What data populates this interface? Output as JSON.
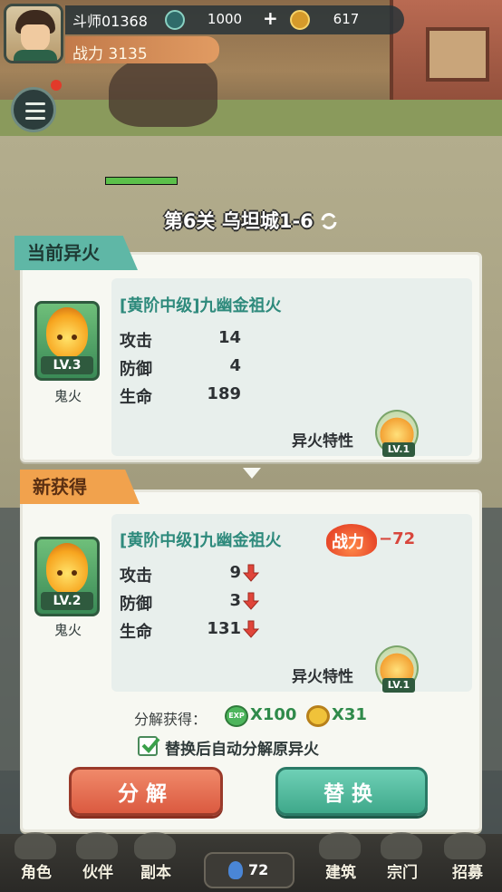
{
  "hud": {
    "player_name": "斗师01368",
    "power": "战力 3135",
    "gem_amount": "1000",
    "coin_amount": "617"
  },
  "stage": {
    "title": "第6关 乌坦城1-6"
  },
  "current_fire": {
    "tab_label": "当前异火",
    "name": "[黄阶中级]九幽金祖火",
    "level": "LV.3",
    "type": "鬼火",
    "stats": [
      {
        "label": "攻击",
        "value": "14"
      },
      {
        "label": "防御",
        "value": "4"
      },
      {
        "label": "生命",
        "value": "189"
      }
    ],
    "trait_label": "异火特性",
    "trait_level": "LV.1"
  },
  "new_fire": {
    "tab_label": "新获得",
    "name": "[黄阶中级]九幽金祖火",
    "power_word": "战力",
    "power_diff": "−72",
    "level": "LV.2",
    "type": "鬼火",
    "stats": [
      {
        "label": "攻击",
        "value": "9"
      },
      {
        "label": "防御",
        "value": "3"
      },
      {
        "label": "生命",
        "value": "131"
      }
    ],
    "trait_label": "异火特性",
    "trait_level": "LV.1"
  },
  "decompose": {
    "label": "分解获得：",
    "exp_icon_text": "EXP",
    "exp_value": "X100",
    "ring_value": "X31"
  },
  "auto_decompose": {
    "label": "替换后自动分解原异火",
    "checked": true
  },
  "buttons": {
    "decompose": "分解",
    "replace": "替换"
  },
  "bottom_nav": {
    "items": [
      "角色",
      "伙伴",
      "副本",
      "建筑",
      "宗门",
      "招募"
    ],
    "center_value": "72"
  },
  "colors": {
    "accent_teal": "#5fb7a6",
    "accent_orange": "#f1a24d",
    "decrease_red": "#e0453a",
    "decompose_button": "#db5a40",
    "replace_button": "#3fa88a"
  },
  "icons": [
    "gem-icon",
    "plus-icon",
    "coin-icon",
    "menu-icon",
    "refresh-icon",
    "down-arrow-icon",
    "exp-icon",
    "ring-coin-icon",
    "check-icon",
    "fire-icon"
  ]
}
